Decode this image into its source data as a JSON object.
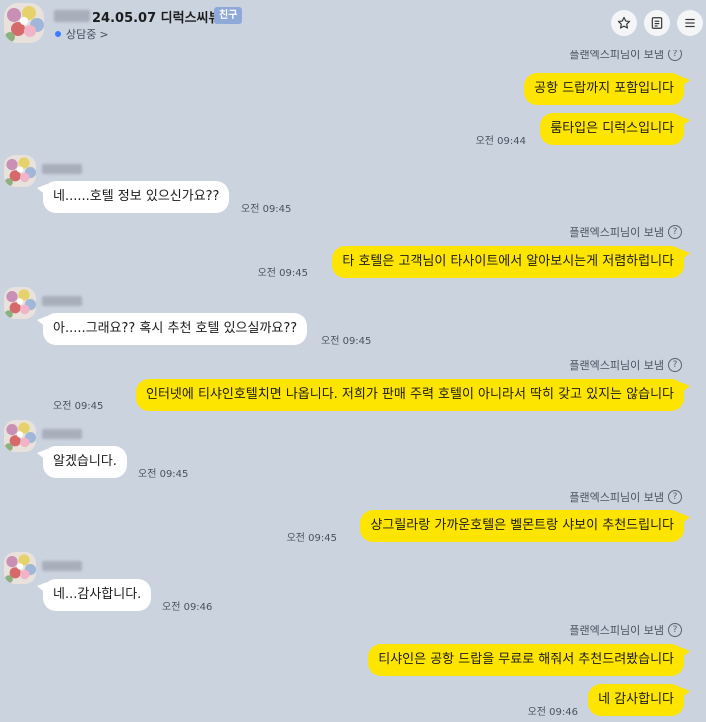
{
  "header": {
    "title": "24.05.07 디럭스씨뷰",
    "badge": "친구",
    "status": "상담중",
    "status_chevron": ">",
    "buttons": [
      "star-icon",
      "menu-doc-icon",
      "hamburger-icon"
    ]
  },
  "colors": {
    "background": "#cbd3df",
    "my_bubble": "#fee500",
    "their_bubble": "#ffffff",
    "badge": "#8ea8d8",
    "status_dot": "#3a7bff"
  },
  "messages": [
    {
      "side": "me",
      "sender": "플랜엑스피님이 보냄",
      "text": "공항 드랍까지 포함입니다",
      "time": ""
    },
    {
      "side": "me",
      "sender": "",
      "text": "룸타입은 디럭스입니다",
      "time": "오전 09:44"
    },
    {
      "side": "them",
      "text": "네......호텔 정보 있으신가요??",
      "time": "오전 09:45"
    },
    {
      "side": "me",
      "sender": "플랜엑스피님이 보냄",
      "text": "타 호텔은 고객님이 타사이트에서 알아보시는게 저렴하럽니다",
      "time": "오전 09:45"
    },
    {
      "side": "them",
      "text": "아.....그래요?? 혹시 추천 호텔 있으실까요??",
      "time": "오전 09:45"
    },
    {
      "side": "me",
      "sender": "플랜엑스피님이 보냄",
      "text": "인터넷에 티샤인호텔치면 나옵니다. 저희가 판매 주력 호텔이 아니라서 딱히 갖고 있지는 않습니다",
      "time": "오전 09:45"
    },
    {
      "side": "them",
      "text": "알겠습니다.",
      "time": "오전 09:45"
    },
    {
      "side": "me",
      "sender": "플랜엑스피님이 보냄",
      "text": "샹그릴라랑 가까운호텔은 벨몬트랑 샤보이 추천드립니다",
      "time": "오전 09:45"
    },
    {
      "side": "them",
      "text": "네...감사합니다.",
      "time": "오전 09:46"
    },
    {
      "side": "me",
      "sender": "플랜엑스피님이 보냄",
      "text": "티샤인은 공항 드랍을 무료로 해줘서 추천드려봤습니다",
      "time": ""
    },
    {
      "side": "me",
      "sender": "",
      "text": "네 감사합니다",
      "time": "오전 09:46"
    }
  ]
}
